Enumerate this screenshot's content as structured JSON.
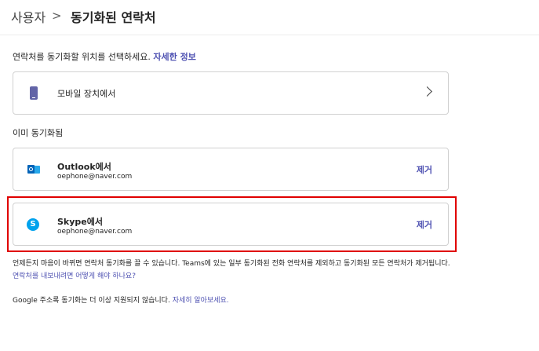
{
  "breadcrumb": {
    "root": "사용자",
    "separator": ">",
    "current": "동기화된 연락처"
  },
  "intro": {
    "text": "연락처를 동기화할 위치를 선택하세요.",
    "link": "자세한 정보"
  },
  "mobile": {
    "label": "모바일 장치에서",
    "icon": "mobile-device-icon"
  },
  "synced_section": {
    "label": "이미 동기화됨"
  },
  "accounts": [
    {
      "title": "Outlook에서",
      "email": "oephone@naver.com",
      "remove_label": "제거",
      "icon": "outlook-icon"
    },
    {
      "title": "Skype에서",
      "email": "oephone@naver.com",
      "remove_label": "제거",
      "icon": "skype-icon",
      "icon_glyph": "S"
    }
  ],
  "notes": {
    "remove_info": "언제든지 마음이 바뀌면 연락처 동기화를 끌 수 있습니다. Teams에 있는 일부 동기화된 전화 연락처를 제외하고 동기화된 모든 연락처가 제거됩니다.",
    "export_link": "연락처를 내보내려면 어떻게 해야 하나요?",
    "google_info": "Google 주소록 동기화는 더 이상 지원되지 않습니다.",
    "google_link": "자세히 알아보세요."
  },
  "colors": {
    "accent": "#4f52b2",
    "highlight_border": "#e00000",
    "skype": "#00a2ed",
    "outlook": "#0364b8"
  }
}
